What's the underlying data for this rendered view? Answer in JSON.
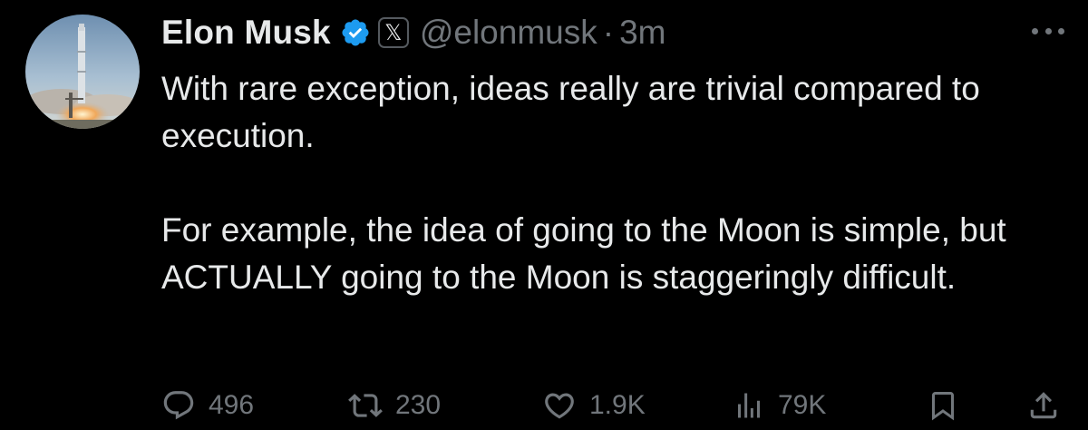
{
  "author": {
    "display_name": "Elon Musk",
    "handle": "@elonmusk",
    "separator": "·",
    "timestamp": "3m",
    "affiliation_glyph": "𝕏",
    "verified_color": "#1d9bf0"
  },
  "tweet": {
    "paragraphs": [
      "With rare exception, ideas really are trivial compared to execution.",
      "For example, the idea of going to the Moon is simple, but ACTUALLY going to the Moon is staggeringly difficult."
    ]
  },
  "actions": {
    "reply_count": "496",
    "retweet_count": "230",
    "like_count": "1.9K",
    "views_count": "79K"
  },
  "icons": {
    "reply": "reply-icon",
    "retweet": "retweet-icon",
    "like": "heart-icon",
    "views": "views-icon",
    "bookmark": "bookmark-icon",
    "share": "share-icon",
    "more": "more-icon"
  },
  "colors": {
    "background": "#000000",
    "text": "#e7e9ea",
    "secondary": "#71767b",
    "accent": "#1d9bf0"
  }
}
